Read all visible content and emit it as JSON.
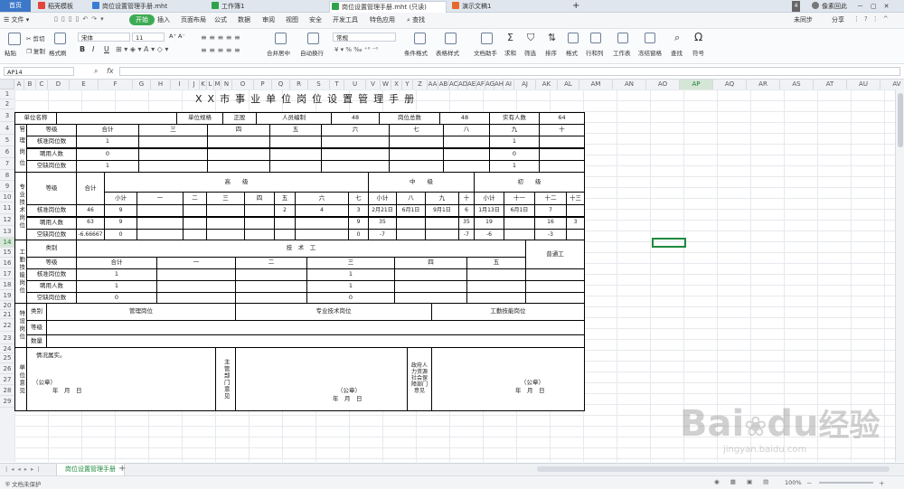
{
  "tabs": {
    "home": "首页",
    "items": [
      {
        "label": "稻壳模板",
        "color": "#e2463b"
      },
      {
        "label": "岗位设置管理手册.mht",
        "color": "#3a7bd5"
      },
      {
        "label": "工作簿1",
        "color": "#2fa24a"
      },
      {
        "label": "岗位设置管理手册.mht (只读)",
        "color": "#2fa24a"
      },
      {
        "label": "演示文稿1",
        "color": "#e8692c"
      }
    ],
    "add": "+",
    "badge": "4",
    "user": "像素回此"
  },
  "menubar": {
    "file": "文件",
    "items": [
      "开始",
      "插入",
      "页面布局",
      "公式",
      "数据",
      "审阅",
      "视图",
      "安全",
      "开发工具",
      "特色应用"
    ],
    "search": "查找",
    "right": [
      "未同步",
      "分享"
    ]
  },
  "toolbar": {
    "paste": "粘贴",
    "cut": "剪切",
    "copy": "复制",
    "format_painter": "格式刷",
    "font": "宋体",
    "size": "11",
    "bold": "B",
    "italic": "I",
    "underline": "U",
    "merge": "合并居中",
    "wrap": "自动换行",
    "num_format": "常规",
    "cond_format": "条件格式",
    "table_style": "表格样式",
    "doc_helper": "文档助手",
    "sum": "求和",
    "filter": "筛选",
    "sort": "排序",
    "format": "格式",
    "rowcol": "行和列",
    "sheet": "工作表",
    "freeze": "冻结窗格",
    "find": "查找",
    "symbol": "符号"
  },
  "formula_bar": {
    "name_box": "AP14",
    "fx": "fx",
    "value": ""
  },
  "columns": [
    "A",
    "B",
    "C",
    "D",
    "E",
    "F",
    "G",
    "H",
    "I",
    "J",
    "K",
    "L",
    "M",
    "N",
    "O",
    "P",
    "Q",
    "R",
    "S",
    "T",
    "U",
    "V",
    "W",
    "X",
    "Y",
    "Z",
    "AA",
    "AB",
    "AC",
    "AD",
    "AE",
    "AF",
    "AG",
    "AH",
    "AI",
    "AJ",
    "AK",
    "AL",
    "AM",
    "AN",
    "AO",
    "AP",
    "AQ",
    "AR",
    "AS",
    "AT",
    "AU",
    "AV"
  ],
  "rows": [
    "1",
    "2",
    "3",
    "4",
    "5",
    "6",
    "7",
    "8",
    "9",
    "10",
    "11",
    "12",
    "13",
    "14",
    "15",
    "16",
    "17",
    "18",
    "19",
    "20",
    "21",
    "22",
    "23",
    "24",
    "25",
    "26",
    "27",
    "28",
    "29"
  ],
  "form": {
    "title": "XX市事业单位岗位设置管理手册",
    "r3": {
      "unit_name": "单位名称",
      "unit_spec": "单位规格",
      "spec_val": "正股",
      "staff_quota": "人员编制",
      "quota_val": "48",
      "total_posts": "岗位总数",
      "posts_val": "48",
      "actual": "实有人数",
      "actual_val": "64"
    },
    "mgmt": {
      "side": "管理岗位",
      "grade": "等级",
      "total": "合计",
      "levels": [
        "三",
        "四",
        "五",
        "六",
        "七",
        "八",
        "九",
        "十"
      ],
      "rows": [
        {
          "label": "核准岗位数",
          "total": "1",
          "nine": "1"
        },
        {
          "label": "聘用人数",
          "total": "0",
          "nine": "0"
        },
        {
          "label": "空缺岗位数",
          "total": "1",
          "nine": "1"
        }
      ]
    },
    "prof": {
      "side": "专业技术岗位",
      "grade": "等级",
      "total": "合计",
      "high": "高　　级",
      "mid": "中　　级",
      "junior": "初　　级",
      "sub": [
        "小计",
        "一",
        "二",
        "三",
        "四",
        "五",
        "六",
        "七",
        "小计",
        "八",
        "九",
        "十",
        "小计",
        "十一",
        "十二",
        "十三"
      ],
      "rows": [
        {
          "label": "核准岗位数",
          "total": "46",
          "cells": [
            "9",
            "",
            "",
            "",
            "",
            "2",
            "4",
            "3",
            "2月21日",
            "6月1日",
            "9月1日",
            "6",
            "1月13日",
            "6月1日",
            "7",
            ""
          ]
        },
        {
          "label": "聘用人数",
          "total": "63",
          "cells": [
            "9",
            "",
            "",
            "",
            "",
            "",
            "",
            "9",
            "35",
            "",
            "",
            "35",
            "19",
            "",
            "16",
            "3"
          ]
        },
        {
          "label": "空缺岗位数",
          "total": "-6.66667",
          "cells": [
            "0",
            "",
            "",
            "",
            "",
            "",
            "",
            "0",
            "-7",
            "",
            "",
            "-7",
            "-6",
            "",
            "-3",
            ""
          ]
        }
      ]
    },
    "worker": {
      "side": "工勤技能岗位",
      "type": "类别",
      "tech": "技　术　工",
      "general": "普通工",
      "grade": "等级",
      "total": "合计",
      "levels": [
        "一",
        "二",
        "三",
        "四",
        "五"
      ],
      "rows": [
        {
          "label": "核准岗位数",
          "total": "1",
          "three": "1"
        },
        {
          "label": "聘用人数",
          "total": "1",
          "three": "1"
        },
        {
          "label": "空缺岗位数",
          "total": "0",
          "three": "0"
        }
      ]
    },
    "special": {
      "side": "特设岗位",
      "type": "类别",
      "grade": "等级",
      "count": "数量",
      "mgmt": "管理岗位",
      "prof": "专业技术岗位",
      "worker": "工勤技能岗位"
    },
    "opinion": {
      "side": "单位意见",
      "note": "情况属实。",
      "seal": "（公章）",
      "date": "年　月　日",
      "dept": "主管部门意见",
      "hr": "政府人力资源社会保障部门意见"
    }
  },
  "sheet_tab": "岗位设置管理手册",
  "sheet_add": "+",
  "status": {
    "protect": "文档未保护",
    "zoom": "100%",
    "zoom_minus": "－",
    "zoom_plus": "＋"
  },
  "watermark": {
    "brand": "Bai",
    "brand2": "du",
    "cn": "经验",
    "url": "jingyan.baidu.com"
  },
  "colors": {
    "accent": "#3dab53",
    "selected_col": "#d5e6d6",
    "home_tab": "#3d77c8"
  }
}
